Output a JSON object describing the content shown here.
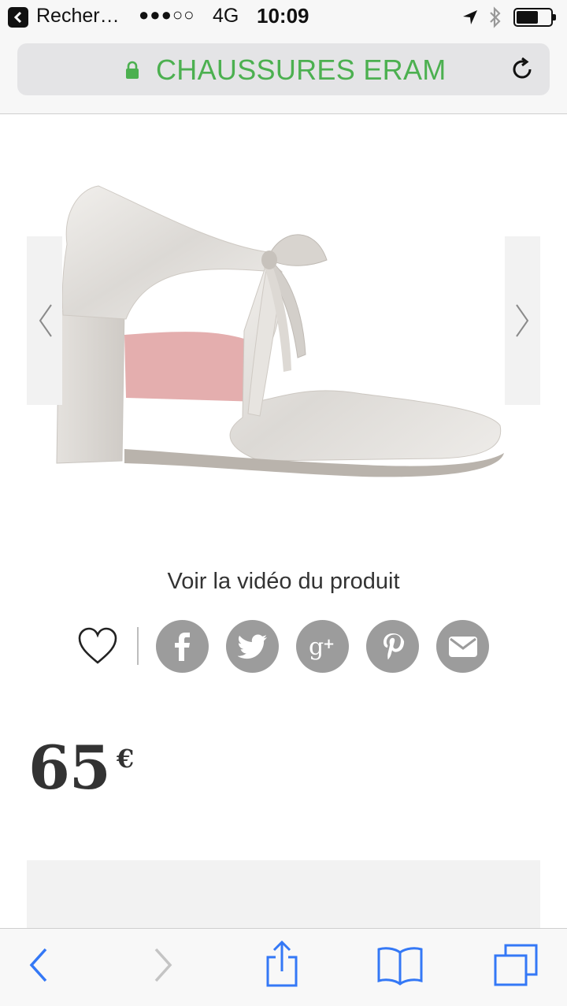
{
  "status_bar": {
    "back_app": "Recher…",
    "signal": "●●●○○",
    "network": "4G",
    "time": "10:09",
    "battery_level": 0.65
  },
  "browser": {
    "url_title": "CHAUSSURES ERAM",
    "secure": true,
    "icons": [
      "lock-icon",
      "reload-icon"
    ]
  },
  "product": {
    "image_icon": "shoe-product-image",
    "video_link": "Voir la vidéo du produit",
    "price": "65",
    "currency": "€"
  },
  "social": {
    "icons": [
      "heart-icon",
      "facebook-icon",
      "twitter-icon",
      "google-plus-icon",
      "pinterest-icon",
      "email-icon"
    ]
  },
  "toolbar": {
    "icons": [
      "back-icon",
      "forward-icon",
      "share-icon",
      "bookmarks-icon",
      "tabs-icon"
    ]
  },
  "colors": {
    "accent_green": "#4cb050",
    "ios_blue": "#3478f6",
    "social_grey": "#9c9c9c"
  }
}
